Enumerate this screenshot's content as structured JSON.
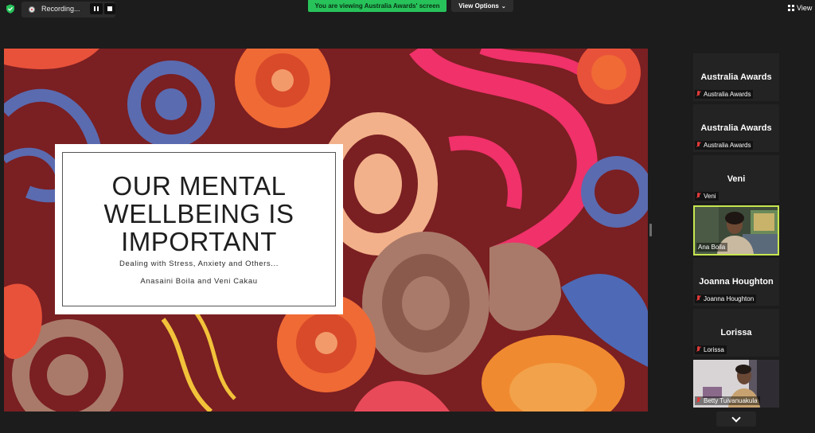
{
  "toolbar": {
    "recording_label": "Recording...",
    "viewing_banner": "You are viewing Australia Awards' screen",
    "view_options_label": "View Options",
    "view_label": "View",
    "shield_color": "#27c25a",
    "viewing_banner_color": "#27c25a"
  },
  "slide": {
    "title": "OUR MENTAL WELLBEING IS IMPORTANT",
    "subtitle": "Dealing with Stress, Anxiety and Others...",
    "authors": "Anasaini Boila and Veni Cakau"
  },
  "participants": [
    {
      "display": "Australia Awards",
      "label": "Australia Awards",
      "muted": true,
      "video": false
    },
    {
      "display": "Australia Awards",
      "label": "Australia Awards",
      "muted": true,
      "video": false
    },
    {
      "display": "Veni",
      "label": "Veni",
      "muted": true,
      "video": false
    },
    {
      "display": "",
      "label": "Ana Boila",
      "muted": false,
      "video": true,
      "active_speaker": true
    },
    {
      "display": "Joanna Houghton",
      "label": "Joanna Houghton",
      "muted": true,
      "video": false
    },
    {
      "display": "Lorissa",
      "label": "Lorissa",
      "muted": true,
      "video": false
    },
    {
      "display": "",
      "label": "Betty Tuivanuakula",
      "muted": true,
      "video": true
    }
  ],
  "colors": {
    "active_speaker_border": "#c7e64f",
    "mute_icon": "#e03a3a"
  }
}
